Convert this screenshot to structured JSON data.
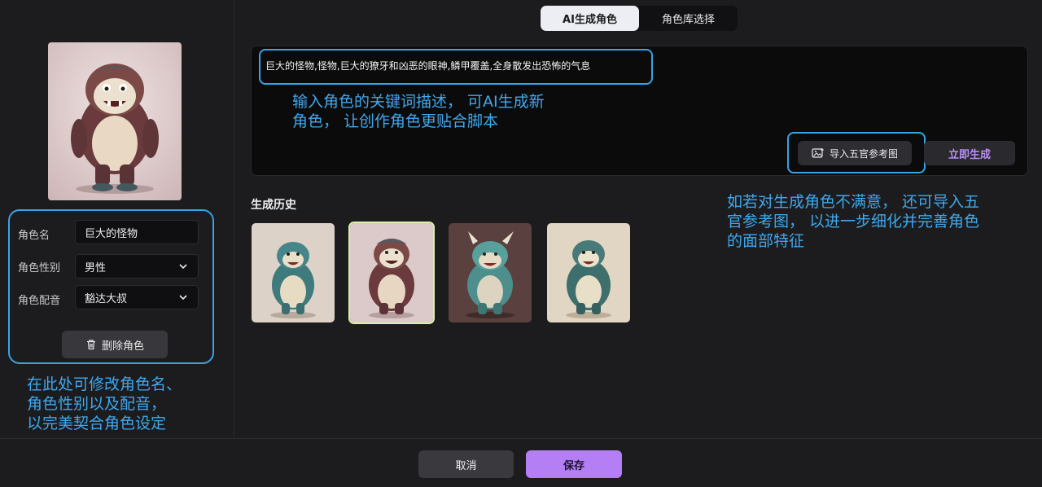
{
  "tabs": [
    {
      "label": "AI生成角色",
      "active": true
    },
    {
      "label": "角色库选择",
      "active": false
    }
  ],
  "prompt": {
    "value": "巨大的怪物,怪物,巨大的獠牙和凶恶的眼神,鳞甲覆盖,全身散发出恐怖的气息"
  },
  "prompt_annotation": [
    "输入角色的关键词描述， 可AI生成新",
    "角色， 让创作角色更贴合脚本"
  ],
  "import_button": {
    "label": "导入五官参考图",
    "icon": "image-upload-icon"
  },
  "generate_button": {
    "label": "立即生成"
  },
  "import_annotation": [
    "如若对生成角色不满意， 还可导入五",
    "官参考图， 以进一步细化并完善角色",
    "的面部特征"
  ],
  "history": {
    "title": "生成历史",
    "items": [
      {
        "name": "monster-1",
        "selected": false
      },
      {
        "name": "monster-2",
        "selected": true
      },
      {
        "name": "monster-3",
        "selected": false
      },
      {
        "name": "monster-4",
        "selected": false
      }
    ]
  },
  "form": {
    "name_label": "角色名",
    "name_value": "巨大的怪物",
    "gender_label": "角色性别",
    "gender_value": "男性",
    "voice_label": "角色配音",
    "voice_value": "豁达大叔"
  },
  "delete_button": {
    "label": "删除角色",
    "icon": "trash-icon"
  },
  "form_annotation": [
    "在此处可修改角色名、",
    "角色性别以及配音，",
    "以完美契合角色设定"
  ],
  "footer": {
    "cancel": "取消",
    "save": "保存"
  },
  "colors": {
    "accent": "#b47ef5",
    "annotation": "#38a3e6",
    "background": "#1c1c1e"
  }
}
